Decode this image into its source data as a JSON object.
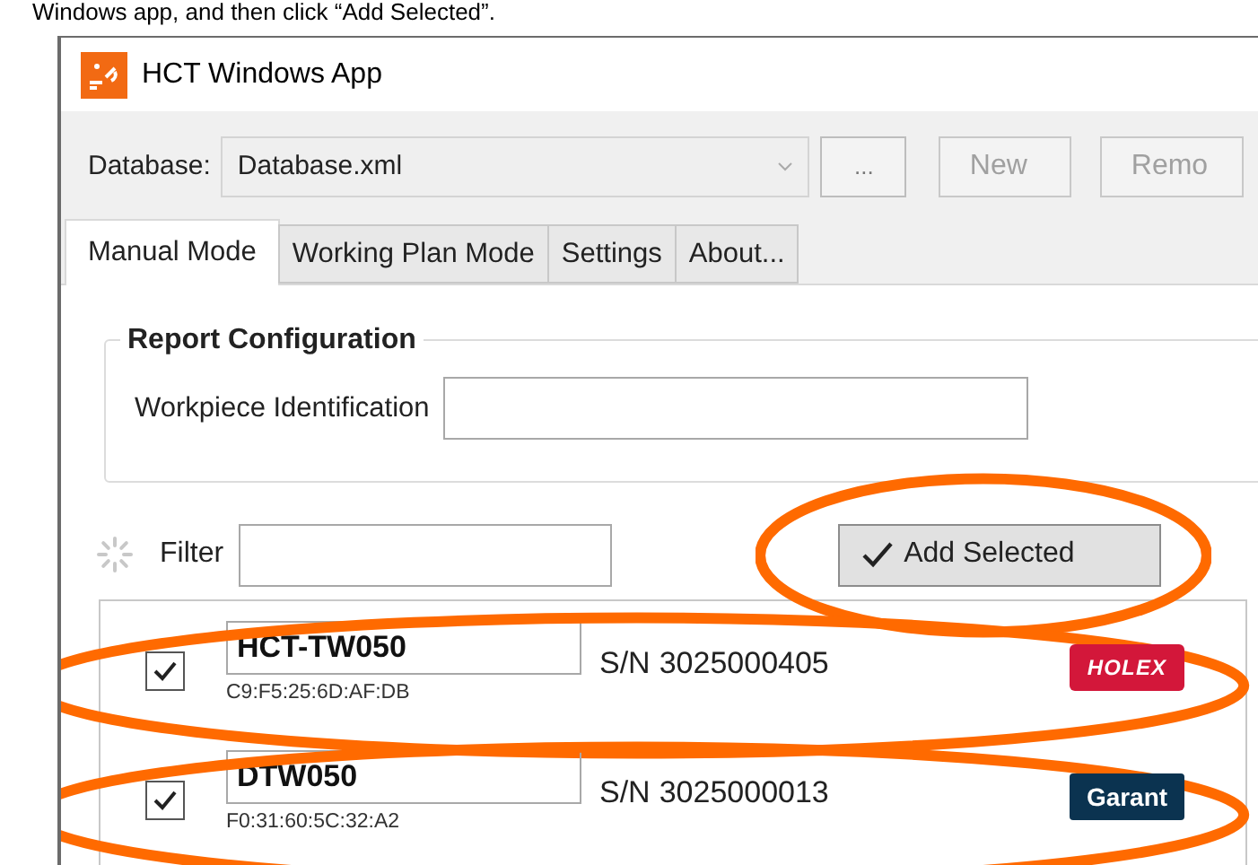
{
  "caption": "Windows app, and then click “Add Selected”.",
  "window": {
    "title": "HCT Windows App"
  },
  "toolbar": {
    "database_label": "Database:",
    "database_value": "Database.xml",
    "browse_button": "...",
    "buttons": [
      {
        "label": "New",
        "disabled": true
      },
      {
        "label": "Remo",
        "disabled": true
      }
    ]
  },
  "tabs": [
    {
      "label": "Manual Mode",
      "selected": true
    },
    {
      "label": "Working Plan Mode",
      "selected": false
    },
    {
      "label": "Settings",
      "selected": false
    },
    {
      "label": "About...",
      "selected": false
    }
  ],
  "report_configuration": {
    "title": "Report Configuration",
    "field_label": "Workpiece Identification"
  },
  "filter": {
    "label": "Filter"
  },
  "add_button": {
    "label": "Add Selected",
    "highlighted": true
  },
  "devices": [
    {
      "name": "HCT-TW050",
      "mac": "C9:F5:25:6D:AF:DB",
      "sn_label": "S/N",
      "serial": "3025000405",
      "brand": "HOLEX",
      "kind": "holex",
      "checked": true,
      "highlighted": true
    },
    {
      "name": "DTW050",
      "mac": "F0:31:60:5C:32:A2",
      "sn_label": "S/N",
      "serial": "3025000013",
      "brand": "Garant",
      "kind": "garant",
      "checked": true,
      "highlighted": true
    }
  ]
}
